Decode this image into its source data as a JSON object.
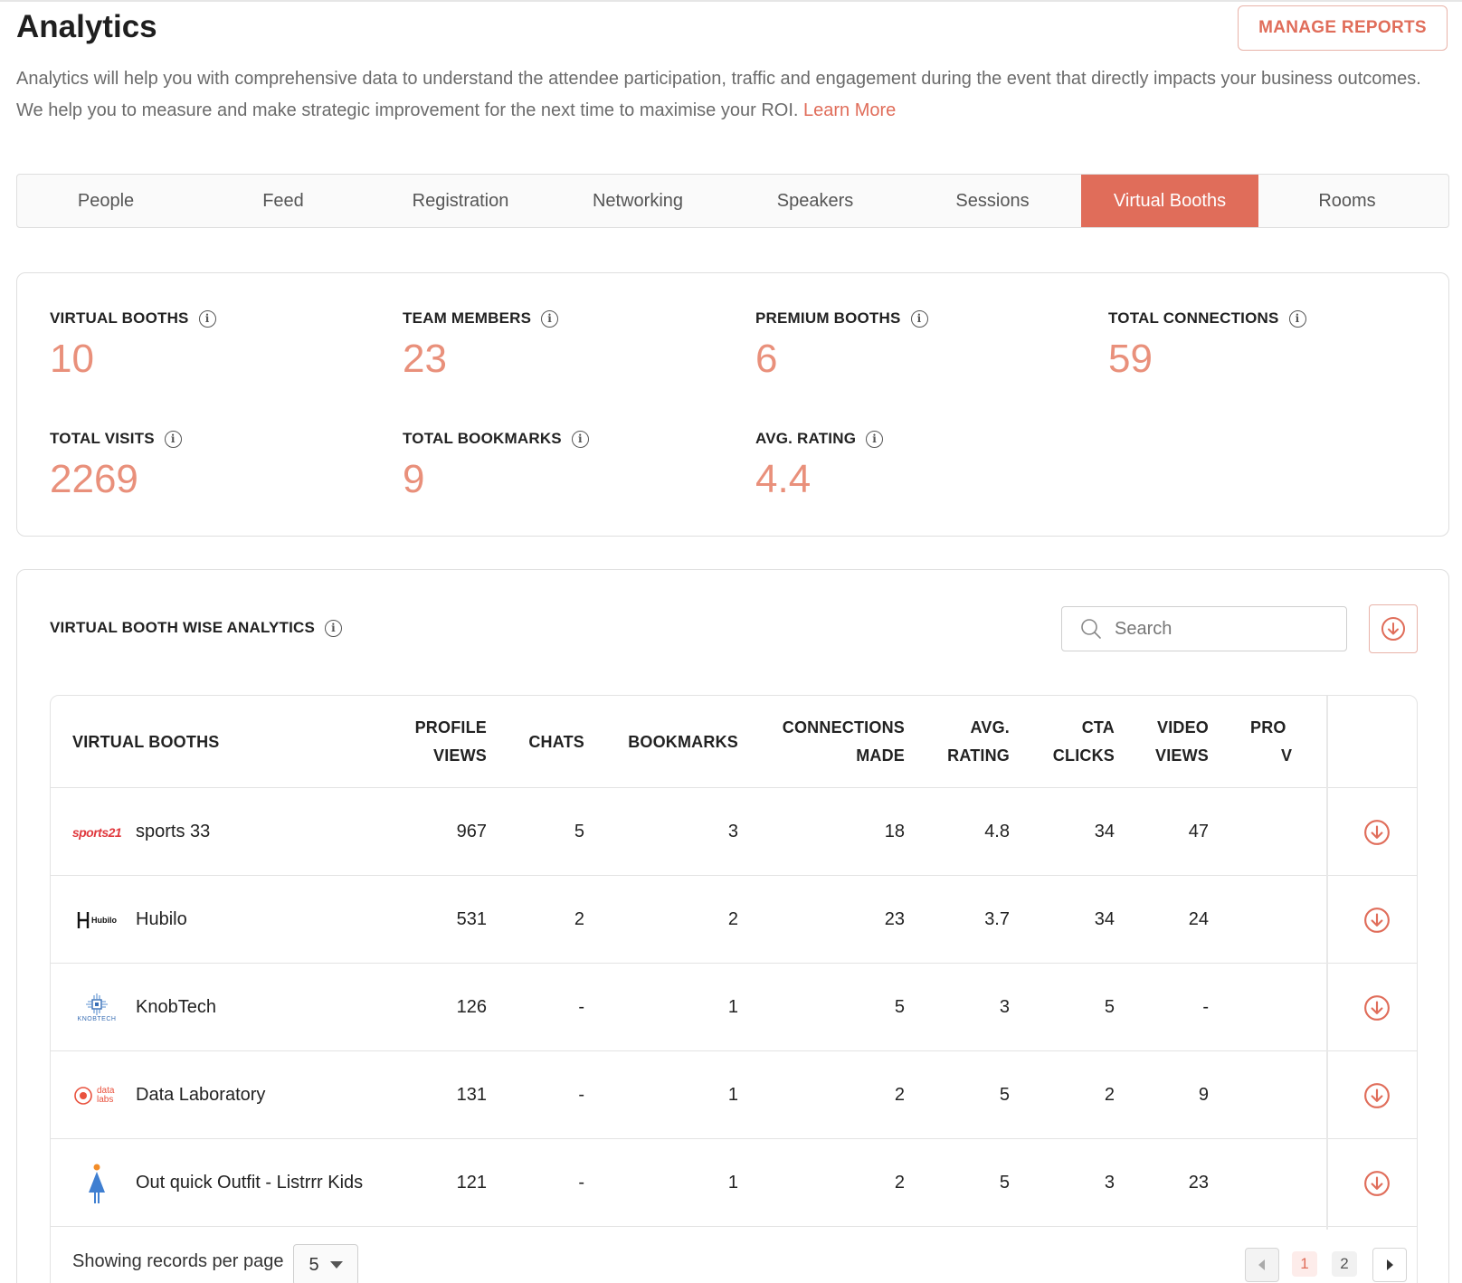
{
  "header": {
    "title": "Analytics",
    "manage_reports_label": "MANAGE REPORTS",
    "description": "Analytics will help you with comprehensive data to understand the attendee participation, traffic and engagement during the event that directly impacts your business outcomes. We help you to measure and make strategic improvement for the next time to maximise your ROI.",
    "learn_more_label": "Learn More"
  },
  "tabs": [
    {
      "label": "People",
      "active": false
    },
    {
      "label": "Feed",
      "active": false
    },
    {
      "label": "Registration",
      "active": false
    },
    {
      "label": "Networking",
      "active": false
    },
    {
      "label": "Speakers",
      "active": false
    },
    {
      "label": "Sessions",
      "active": false
    },
    {
      "label": "Virtual Booths",
      "active": true
    },
    {
      "label": "Rooms",
      "active": false
    }
  ],
  "stats": [
    {
      "label": "VIRTUAL BOOTHS",
      "value": "10"
    },
    {
      "label": "TEAM MEMBERS",
      "value": "23"
    },
    {
      "label": "PREMIUM BOOTHS",
      "value": "6"
    },
    {
      "label": "TOTAL CONNECTIONS",
      "value": "59"
    },
    {
      "label": "TOTAL VISITS",
      "value": "2269"
    },
    {
      "label": "TOTAL BOOKMARKS",
      "value": "9"
    },
    {
      "label": "AVG. RATING",
      "value": "4.4"
    }
  ],
  "booth_analytics": {
    "title": "VIRTUAL BOOTH WISE ANALYTICS",
    "search_placeholder": "Search",
    "columns": {
      "booth": "VIRTUAL BOOTHS",
      "profile_views_1": "PROFILE",
      "profile_views_2": "VIEWS",
      "chats": "CHATS",
      "bookmarks": "BOOKMARKS",
      "connections_1": "CONNECTIONS",
      "connections_2": "MADE",
      "rating_1": "AVG.",
      "rating_2": "RATING",
      "cta_1": "CTA",
      "cta_2": "CLICKS",
      "video_1": "VIDEO",
      "video_2": "VIEWS",
      "pro_1": "PRO",
      "pro_2": "V"
    },
    "rows": [
      {
        "logo": "sports21-logo",
        "logo_text": "sports21",
        "name": "sports 33",
        "profile_views": "967",
        "chats": "5",
        "bookmarks": "3",
        "connections": "18",
        "rating": "4.8",
        "cta_clicks": "34",
        "video_views": "47"
      },
      {
        "logo": "hubilo-logo",
        "logo_text": "Hubilo",
        "name": "Hubilo",
        "profile_views": "531",
        "chats": "2",
        "bookmarks": "2",
        "connections": "23",
        "rating": "3.7",
        "cta_clicks": "34",
        "video_views": "24"
      },
      {
        "logo": "knobtech-logo",
        "logo_text": "KnobTech",
        "name": "KnobTech",
        "profile_views": "126",
        "chats": "-",
        "bookmarks": "1",
        "connections": "5",
        "rating": "3",
        "cta_clicks": "5",
        "video_views": "-"
      },
      {
        "logo": "datalabs-logo",
        "logo_text": "data labs",
        "name": "Data Laboratory",
        "profile_views": "131",
        "chats": "-",
        "bookmarks": "1",
        "connections": "2",
        "rating": "5",
        "cta_clicks": "2",
        "video_views": "9"
      },
      {
        "logo": "kids-logo",
        "logo_text": "",
        "name": "Out quick Outfit - Listrrr Kids",
        "profile_views": "121",
        "chats": "-",
        "bookmarks": "1",
        "connections": "2",
        "rating": "5",
        "cta_clicks": "3",
        "video_views": "23"
      }
    ],
    "footer": {
      "records_label": "Showing records per page",
      "records_value": "5",
      "pages": [
        "1",
        "2"
      ],
      "current_page": "1"
    }
  },
  "colors": {
    "accent": "#e06d5a",
    "stat_value": "#e9907b"
  },
  "icons": [
    "info-icon",
    "search-icon",
    "download-icon",
    "chevron-left-icon",
    "chevron-right-icon",
    "caret-down-icon"
  ]
}
